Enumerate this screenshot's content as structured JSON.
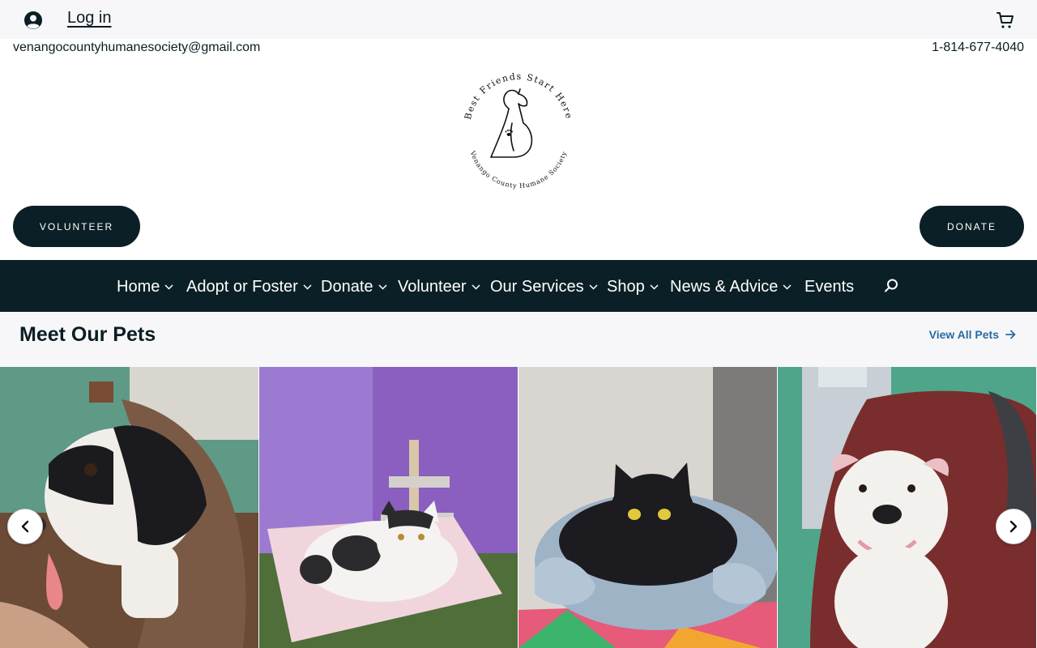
{
  "header": {
    "login_label": "Log in",
    "email": "venangocountyhumanesociety@gmail.com",
    "phone": "1-814-677-4040",
    "account_icon": "account-circle-icon",
    "cart_icon": "cart-icon"
  },
  "logo": {
    "top_text": "Best Friends Start Here",
    "bottom_text": "Venango County Humane Society"
  },
  "cta": {
    "volunteer_label": "VOLUNTEER",
    "donate_label": "DONATE"
  },
  "nav": {
    "items": [
      {
        "label": "Home"
      },
      {
        "label": "Adopt or Foster"
      },
      {
        "label": "Donate"
      },
      {
        "label": "Volunteer"
      },
      {
        "label": "Our Services"
      },
      {
        "label": "Shop"
      },
      {
        "label": "News & Advice"
      },
      {
        "label": "Events"
      }
    ],
    "search_icon": "search-icon"
  },
  "pets": {
    "title": "Meet Our Pets",
    "view_all_label": "View All Pets",
    "cards": [
      {
        "image": "black-and-white-dog-photo"
      },
      {
        "image": "white-and-black-cat-photo"
      },
      {
        "image": "black-cat-in-bed-photo"
      },
      {
        "image": "white-pitbull-photo"
      }
    ]
  },
  "colors": {
    "brand_dark": "#0b2026",
    "top_bar_bg": "#f7f7f9",
    "link_blue": "#2a6ba3"
  }
}
